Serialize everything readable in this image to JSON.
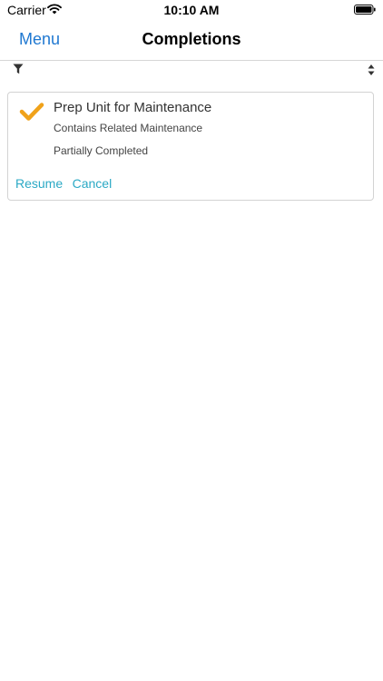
{
  "status_bar": {
    "carrier": "Carrier",
    "time": "10:10 AM"
  },
  "nav": {
    "back_label": "Menu",
    "title": "Completions"
  },
  "toolbar": {
    "filter_icon": "filter-icon",
    "sort_icon": "sort-icon"
  },
  "completion_card": {
    "title": "Prep Unit for Maintenance",
    "subtitle": "Contains Related Maintenance",
    "status": "Partially Completed",
    "actions": {
      "resume_label": "Resume",
      "cancel_label": "Cancel"
    }
  },
  "colors": {
    "accent_blue": "#1f78d1",
    "link_teal": "#2ba9c5",
    "check_orange": "#f0a21a"
  }
}
